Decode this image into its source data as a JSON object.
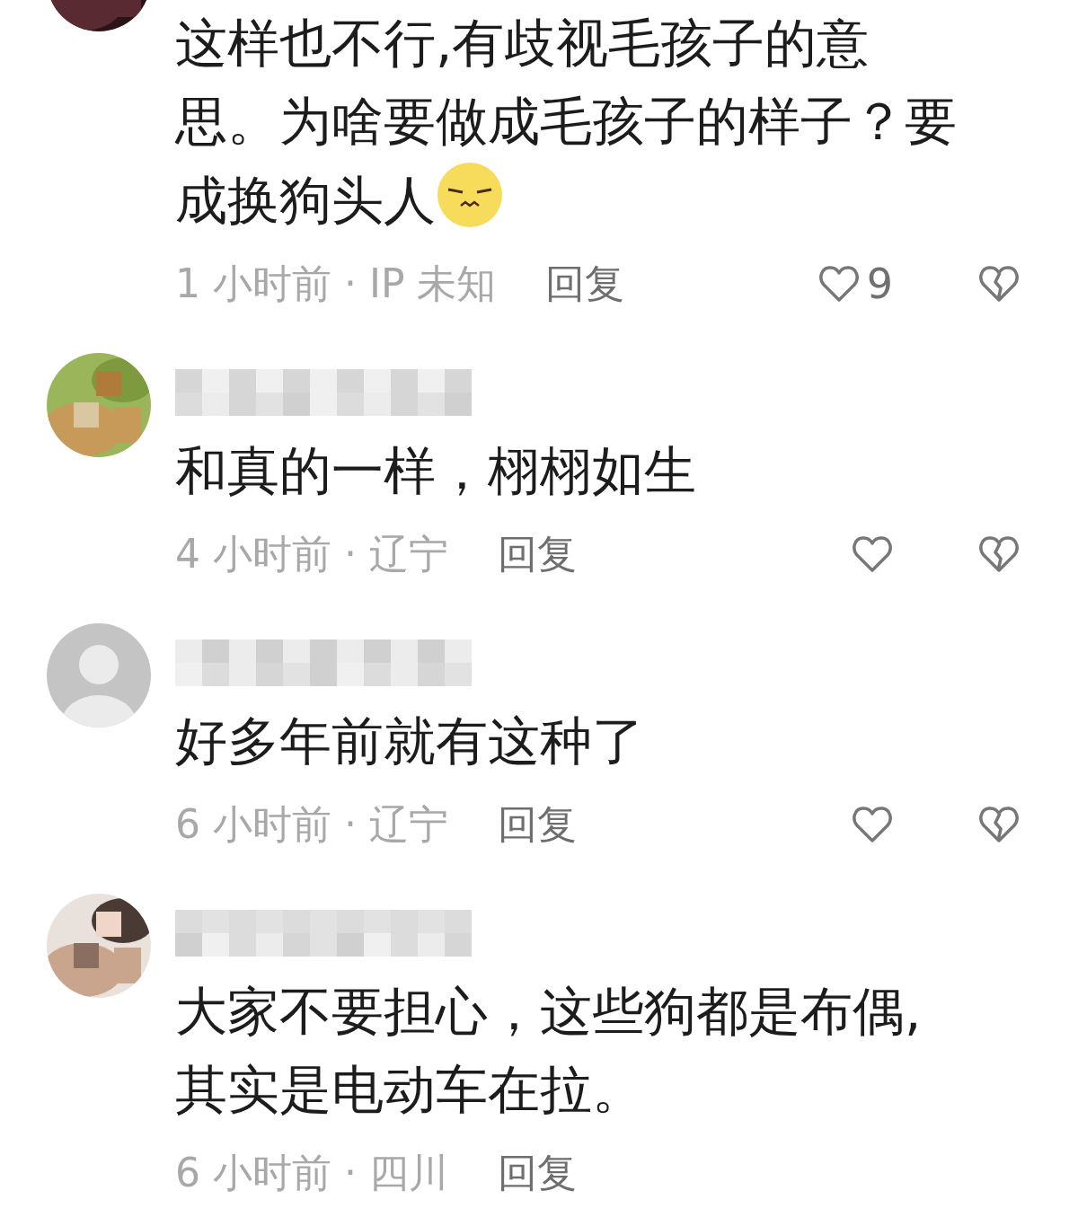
{
  "comments": [
    {
      "name_shown": false,
      "text": "这样也不行,有歧视毛孩子的意思。为啥要做成毛孩子的样子？要成换狗头人",
      "emoji": true,
      "time_location": "1 小时前 · IP 未知",
      "reply": "回复",
      "reactions": true,
      "like_count": "9"
    },
    {
      "name_shown": true,
      "text": "和真的一样，栩栩如生",
      "emoji": false,
      "time_location": "4 小时前 · 辽宁",
      "reply": "回复",
      "reactions": true
    },
    {
      "avatar": {
        "kind": "default"
      },
      "name_shown": true,
      "text": "好多年前就有这种了",
      "emoji": false,
      "time_location": "6 小时前 · 辽宁",
      "reply": "回复",
      "reactions": true
    },
    {
      "name_shown": true,
      "text": "大家不要担心，这些狗都是布偶,其实是电动车在拉。",
      "emoji": false,
      "time_location": "6 小时前 · 四川",
      "reply": "回复",
      "reactions": false
    }
  ]
}
